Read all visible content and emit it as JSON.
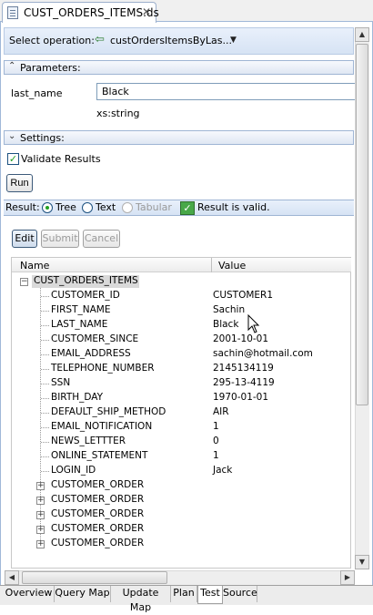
{
  "editor": {
    "tab_title": "CUST_ORDERS_ITEMS.ds",
    "close_glyph": "✕"
  },
  "operation": {
    "label": "Select operation:",
    "selected": "custOrdersItemsByLas...",
    "icon": "operation-icon"
  },
  "parameters": {
    "header": "Parameters:",
    "toggle_glyph": "⌃",
    "param_name": "last_name",
    "param_value": "Black",
    "param_type": "xs:string"
  },
  "settings": {
    "header": "Settings:",
    "toggle_glyph": "⌄",
    "validate_label": "Validate Results",
    "validate_checked": true,
    "run_label": "Run"
  },
  "result": {
    "label": "Result:",
    "options": [
      "Tree",
      "Text",
      "Tabular"
    ],
    "selected": "Tree",
    "status": "Result is valid."
  },
  "actions": {
    "edit": "Edit",
    "submit": "Submit",
    "cancel": "Cancel"
  },
  "tree": {
    "col_name": "Name",
    "col_value": "Value",
    "root": "CUST_ORDERS_ITEMS",
    "expand_glyph": "+",
    "collapse_glyph": "−",
    "rows": [
      {
        "name": "CUSTOMER_ID",
        "value": "CUSTOMER1"
      },
      {
        "name": "FIRST_NAME",
        "value": "Sachin"
      },
      {
        "name": "LAST_NAME",
        "value": "Black"
      },
      {
        "name": "CUSTOMER_SINCE",
        "value": "2001-10-01"
      },
      {
        "name": "EMAIL_ADDRESS",
        "value": "sachin@hotmail.com"
      },
      {
        "name": "TELEPHONE_NUMBER",
        "value": "2145134119"
      },
      {
        "name": "SSN",
        "value": "295-13-4119"
      },
      {
        "name": "BIRTH_DAY",
        "value": "1970-01-01"
      },
      {
        "name": "DEFAULT_SHIP_METHOD",
        "value": "AIR"
      },
      {
        "name": "EMAIL_NOTIFICATION",
        "value": "1"
      },
      {
        "name": "NEWS_LETTTER",
        "value": "0"
      },
      {
        "name": "ONLINE_STATEMENT",
        "value": "1"
      },
      {
        "name": "LOGIN_ID",
        "value": "Jack"
      }
    ],
    "children": [
      "CUSTOMER_ORDER",
      "CUSTOMER_ORDER",
      "CUSTOMER_ORDER",
      "CUSTOMER_ORDER",
      "CUSTOMER_ORDER"
    ]
  },
  "scroll": {
    "up": "▲",
    "down": "▼",
    "left": "◀",
    "right": "▶"
  },
  "bottom_tabs": [
    "Overview",
    "Query Map",
    "Update Map",
    "Plan",
    "Test",
    "Source"
  ],
  "active_bottom_tab": "Test",
  "colors": {
    "accent": "#21a121",
    "section": "#dfe7f3"
  }
}
